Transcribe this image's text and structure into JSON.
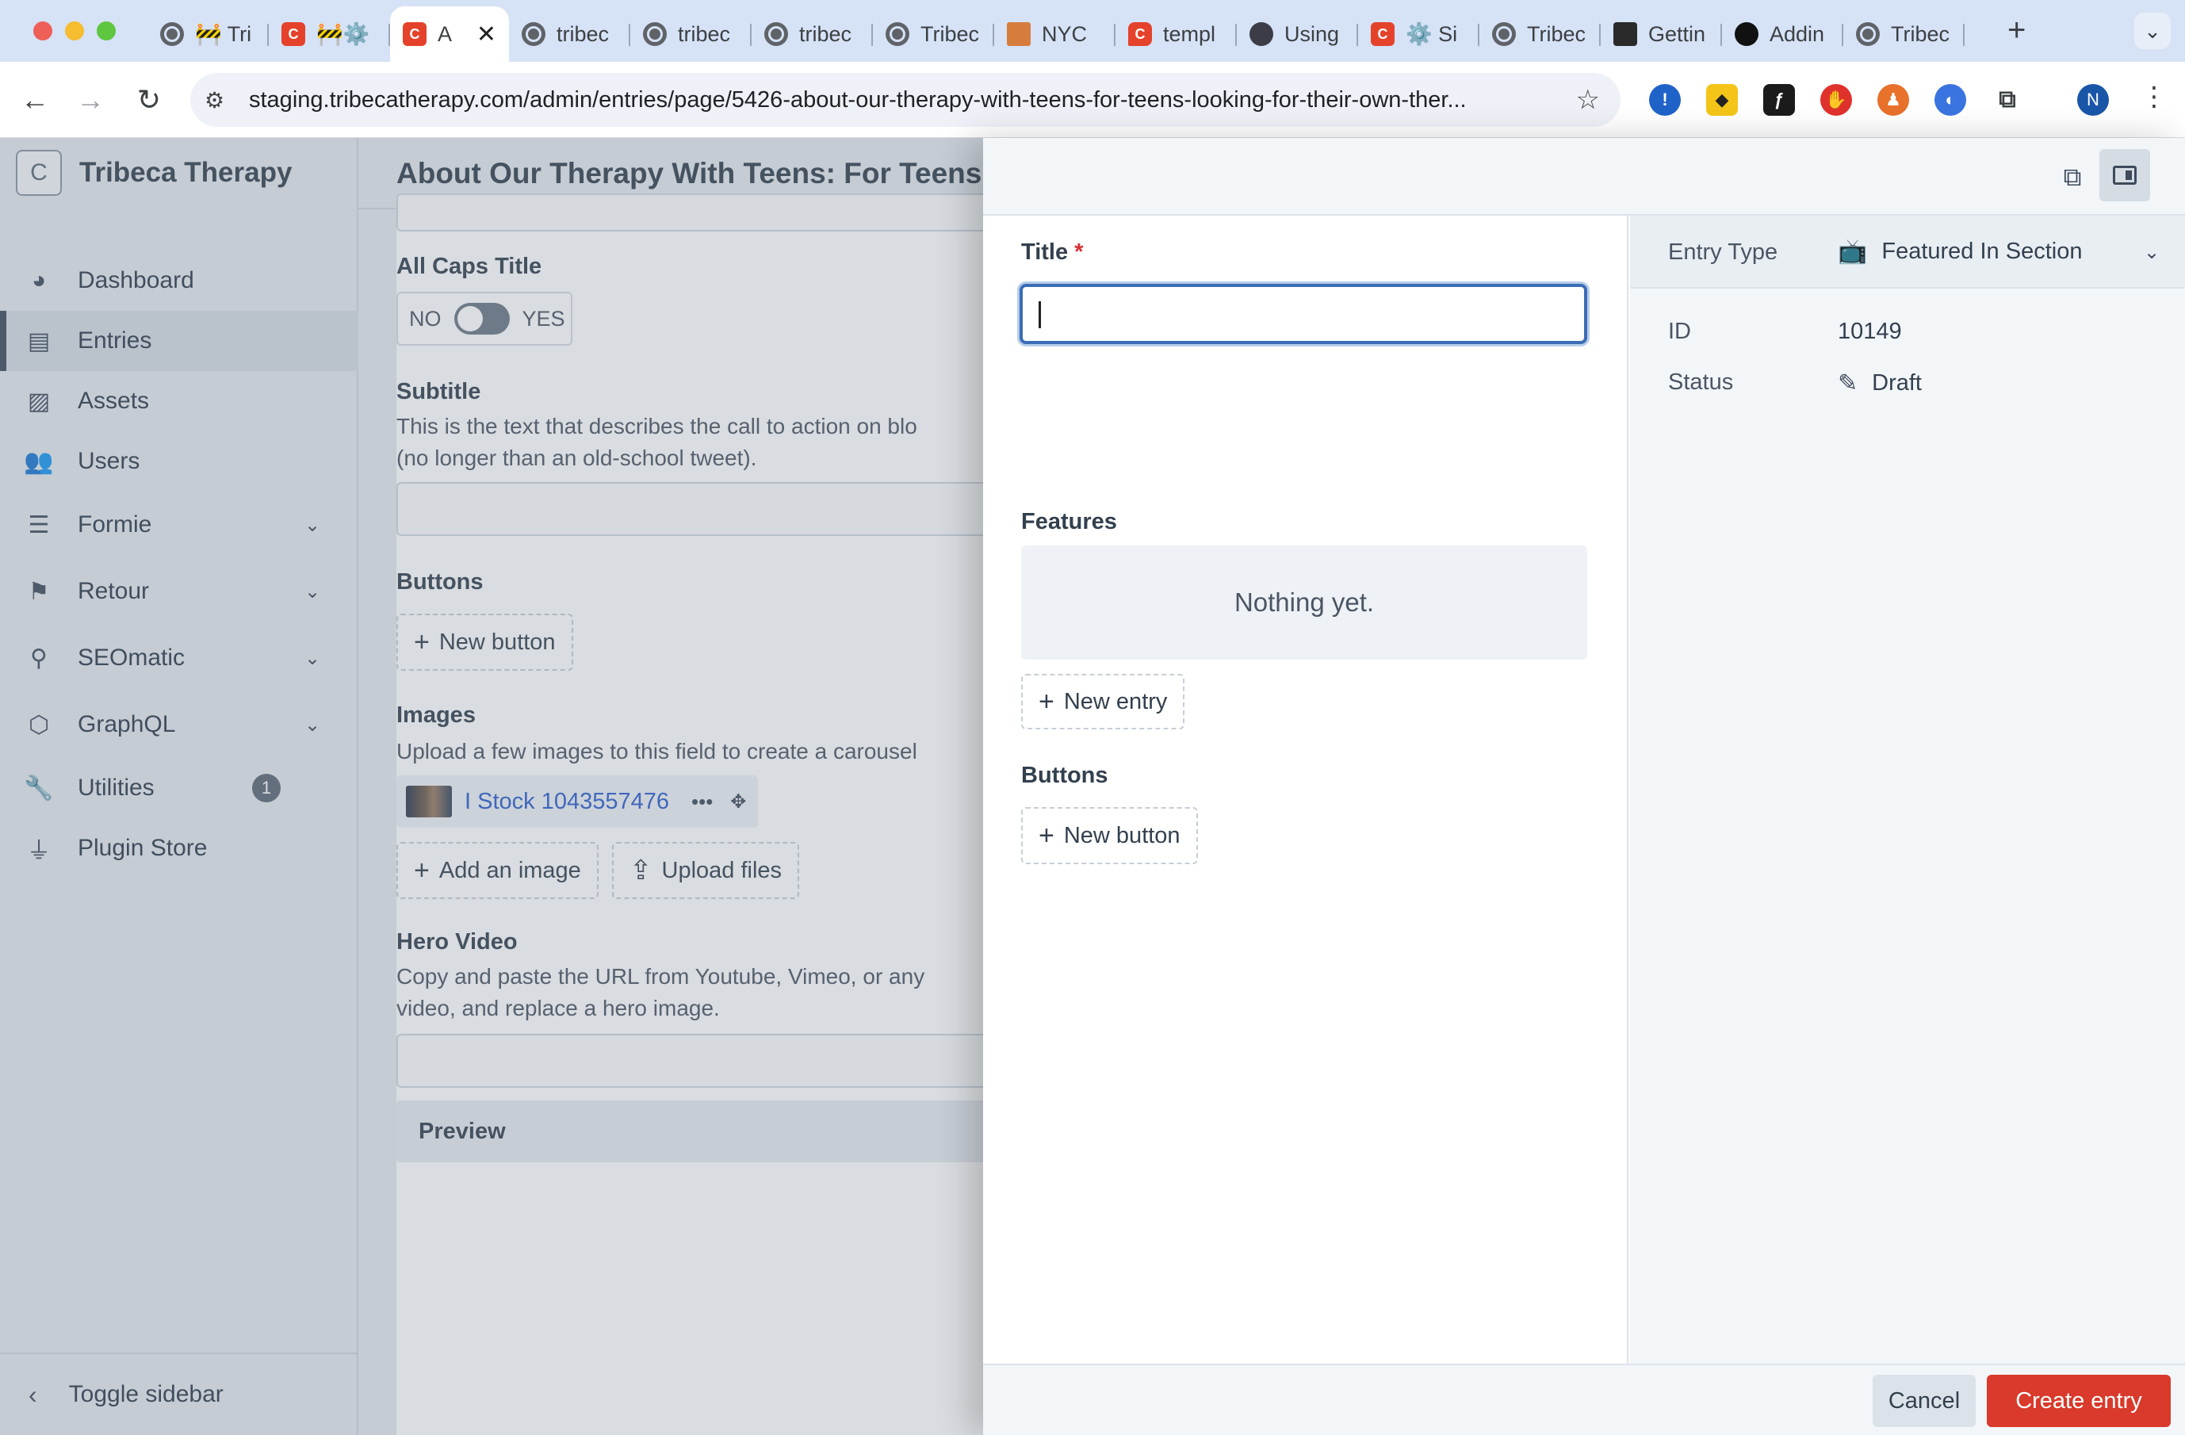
{
  "browser": {
    "tabs": [
      {
        "label": "🚧 Tri",
        "icon": "globe-icon"
      },
      {
        "label": "🚧⚙️",
        "icon": "craft-icon"
      },
      {
        "label": "A",
        "icon": "craft-icon",
        "active": true
      },
      {
        "label": "tribec",
        "icon": "globe-icon"
      },
      {
        "label": "tribec",
        "icon": "globe-icon"
      },
      {
        "label": "tribec",
        "icon": "globe-icon"
      },
      {
        "label": "Tribec",
        "icon": "globe-icon"
      },
      {
        "label": "NYC",
        "icon": "nyc-icon"
      },
      {
        "label": "templ",
        "icon": "note-icon"
      },
      {
        "label": "Using",
        "icon": "dark-icon"
      },
      {
        "label": "⚙️ Si",
        "icon": "craft-icon"
      },
      {
        "label": "Tribec",
        "icon": "globe-icon"
      },
      {
        "label": "Gettin",
        "icon": "book-icon"
      },
      {
        "label": "Addin",
        "icon": "github-icon"
      },
      {
        "label": "Tribec",
        "icon": "globe-icon"
      }
    ],
    "url": "staging.tribecatherapy.com/admin/entries/page/5426-about-our-therapy-with-teens-for-teens-looking-for-their-own-ther...",
    "profile_initial": "N"
  },
  "sidebar": {
    "site_logo": "C",
    "site_name": "Tribeca Therapy",
    "items": [
      {
        "label": "Dashboard",
        "icon": "dashboard-icon"
      },
      {
        "label": "Entries",
        "icon": "entries-icon",
        "selected": true
      },
      {
        "label": "Assets",
        "icon": "image-icon"
      },
      {
        "label": "Users",
        "icon": "users-icon"
      },
      {
        "label": "Formie",
        "icon": "form-icon",
        "expandable": true
      },
      {
        "label": "Retour",
        "icon": "signpost-icon",
        "expandable": true
      },
      {
        "label": "SEOmatic",
        "icon": "seomatic-icon",
        "expandable": true
      },
      {
        "label": "GraphQL",
        "icon": "graphql-icon",
        "expandable": true
      },
      {
        "label": "Utilities",
        "icon": "wrench-icon",
        "badge": "1"
      },
      {
        "label": "Plugin Store",
        "icon": "plug-icon"
      }
    ],
    "toggle_label": "Toggle sidebar"
  },
  "main": {
    "title": "About Our Therapy With Teens: For Teens L",
    "fields": {
      "all_caps_title": {
        "label": "All Caps Title",
        "no": "NO",
        "yes": "YES"
      },
      "subtitle": {
        "label": "Subtitle",
        "instructions_1": "This is the text that describes the call to action on blo",
        "instructions_2": "(no longer than an old-school tweet)."
      },
      "buttons": {
        "label": "Buttons",
        "new_button": "New button"
      },
      "images": {
        "label": "Images",
        "instructions": "Upload a few images to this field to create a carousel",
        "asset_name": "I Stock 1043557476",
        "add_image": "Add an image",
        "upload_files": "Upload files"
      },
      "hero_video": {
        "label": "Hero Video",
        "instructions_1": "Copy and paste the URL from Youtube, Vimeo, or any",
        "instructions_2": "video, and replace a hero image."
      },
      "preview": {
        "label": "Preview"
      }
    }
  },
  "slideout": {
    "title_label": "Title",
    "required_mark": "*",
    "features_label": "Features",
    "features_empty": "Nothing yet.",
    "new_entry": "New entry",
    "buttons_label": "Buttons",
    "new_button": "New button",
    "meta": {
      "entry_type_key": "Entry Type",
      "entry_type_value": "Featured In Section",
      "id_key": "ID",
      "id_value": "10149",
      "status_key": "Status",
      "status_value": "Draft"
    },
    "cancel": "Cancel",
    "create": "Create entry"
  },
  "colors": {
    "accent_red": "#d93a2b",
    "focus_blue": "#3b6db6",
    "link_blue": "#2b5dcc",
    "sidebar_bg": "#e4e9ef"
  }
}
